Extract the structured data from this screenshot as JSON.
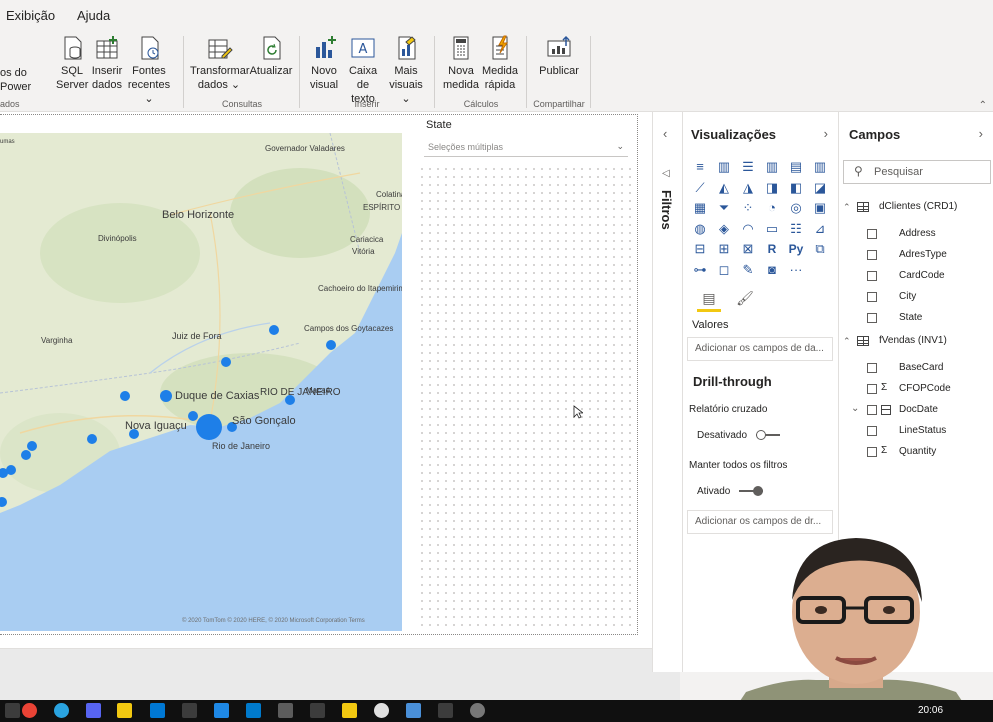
{
  "menu": {
    "items": [
      "Exibição",
      "Ajuda"
    ]
  },
  "ribbon": {
    "partial_button_label": "os do Power",
    "partial_group_label": "ados",
    "buttons": {
      "sql": [
        "SQL",
        "Server"
      ],
      "enter": [
        "Inserir",
        "dados"
      ],
      "recent": [
        "Fontes",
        "recentes ⌄"
      ],
      "transform": [
        "Transformar",
        "dados ⌄"
      ],
      "refresh": [
        "Atualizar"
      ],
      "new_visual": [
        "Novo",
        "visual"
      ],
      "textbox": [
        "Caixa de",
        "texto"
      ],
      "more_visuals": [
        "Mais",
        "visuais ⌄"
      ],
      "new_measure": [
        "Nova",
        "medida"
      ],
      "quick_measure": [
        "Medida",
        "rápida"
      ],
      "publish": [
        "Publicar"
      ]
    },
    "groups": {
      "queries": "Consultas",
      "insert": "Inserir",
      "calculations": "Cálculos",
      "share": "Compartilhar"
    }
  },
  "map": {
    "cities": [
      "Governador Valadares",
      "Colatina",
      "ESPÍRITO",
      "Belo Horizonte",
      "Divinópolis",
      "Cariacica",
      "Vitória",
      "Espí",
      "Cachoeiro do Itapemirim",
      "Campos dos Goytacazes",
      "Juiz de Fora",
      "Varginha",
      "Duque de Caxias",
      "RIO DE JANEIRO",
      "Macaé",
      "São Gonçalo",
      "Nova Iguaçu",
      "Rio de Janeiro"
    ],
    "credit": "© 2020 TomTom © 2020 HERE, © 2020 Microsoft Corporation Terms",
    "colors": {
      "water": "#a9cdf2",
      "land": "#e4ead2",
      "bubble": "#1e7fe8"
    },
    "top_label": "umas"
  },
  "slicer": {
    "title": "State",
    "placeholder": "Seleções múltiplas"
  },
  "filters": {
    "label": "Filtros"
  },
  "visualizations": {
    "title": "Visualizações",
    "icons": [
      "stacked-bar",
      "stacked-column",
      "clustered-bar",
      "clustered-column",
      "100-bar",
      "100-column",
      "line",
      "area",
      "stacked-area",
      "line-column",
      "line-clustered",
      "ribbon",
      "waterfall",
      "funnel",
      "scatter",
      "pie",
      "donut",
      "treemap",
      "map",
      "filled-map",
      "gauge",
      "card",
      "multirow-card",
      "kpi",
      "slicer",
      "table",
      "matrix",
      "r-visual",
      "python-visual",
      "key-influencers",
      "decomp-tree",
      "qa",
      "smart-narrative",
      "paginated",
      "more"
    ],
    "values_label": "Valores",
    "values_well": "Adicionar os campos de da...",
    "drill_title": "Drill-through",
    "cross_report_label": "Relatório cruzado",
    "cross_report_state": "Desativado",
    "keep_filters_label": "Manter todos os filtros",
    "keep_filters_state": "Ativado",
    "drill_well": "Adicionar os campos de dr..."
  },
  "fields": {
    "title": "Campos",
    "search_placeholder": "Pesquisar",
    "tables": [
      {
        "name": "dClientes (CRD1)",
        "fields": [
          "Address",
          "AdresType",
          "CardCode",
          "City",
          "State"
        ]
      },
      {
        "name": "fVendas (INV1)",
        "fields": [
          "BaseCard",
          "CFOPCode",
          "DocDate",
          "LineStatus",
          "Quantity"
        ]
      }
    ]
  },
  "taskbar": {
    "clock": "20:06"
  }
}
